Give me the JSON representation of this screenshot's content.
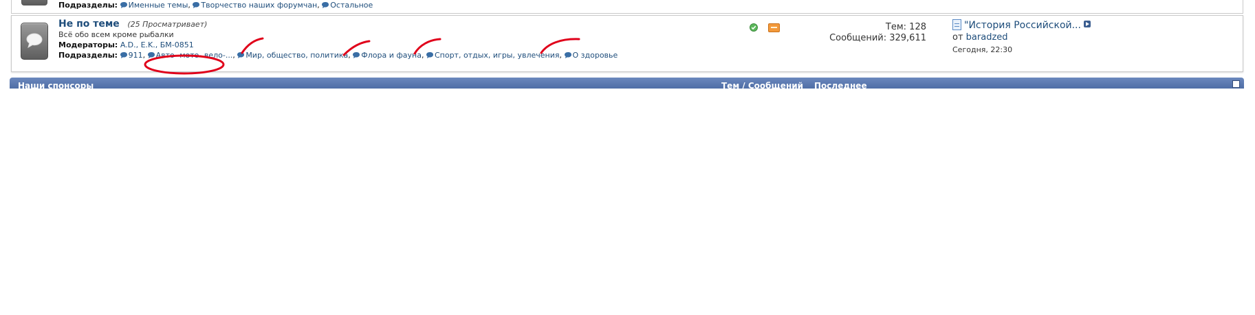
{
  "top_row": {
    "subforums_label": "Подразделы:",
    "subforums": [
      "Именные темы",
      "Творчество наших форумчан",
      "Остальное"
    ]
  },
  "forum": {
    "title": "Не по теме",
    "viewers": "(25 Просматривает)",
    "description": "Всё обо всем кроме рыбалки",
    "moderators_label": "Модераторы:",
    "moderators": "A.D., E.K., БМ-0851",
    "subforums_label": "Подразделы:",
    "subforums": [
      "911",
      "Авто- мото- вело-...",
      "Мир, общество, политика",
      "Флора и фауна",
      "Спорт, отдых, игры, увлечения",
      "О здоровье"
    ],
    "stats": {
      "threads": "Тем: 128",
      "posts": "Сообщений: 329,611"
    },
    "last_post": {
      "title": "\"История Российской...",
      "by_prefix": "от",
      "author": "baradzed",
      "date": "Сегодня,",
      "time": "22:30"
    }
  },
  "category_bar": {
    "title": "Наши спонсоры",
    "col_threads": "Тем / Сообщений",
    "col_last": "Последнее"
  },
  "colors": {
    "link": "#1e4d7b",
    "header": "#5a78ae",
    "annotation": "#e0001a"
  },
  "icons": [
    "speech-bubble-icon",
    "status-ok-icon",
    "rss-icon",
    "document-icon",
    "goto-last-icon",
    "collapse-icon"
  ]
}
